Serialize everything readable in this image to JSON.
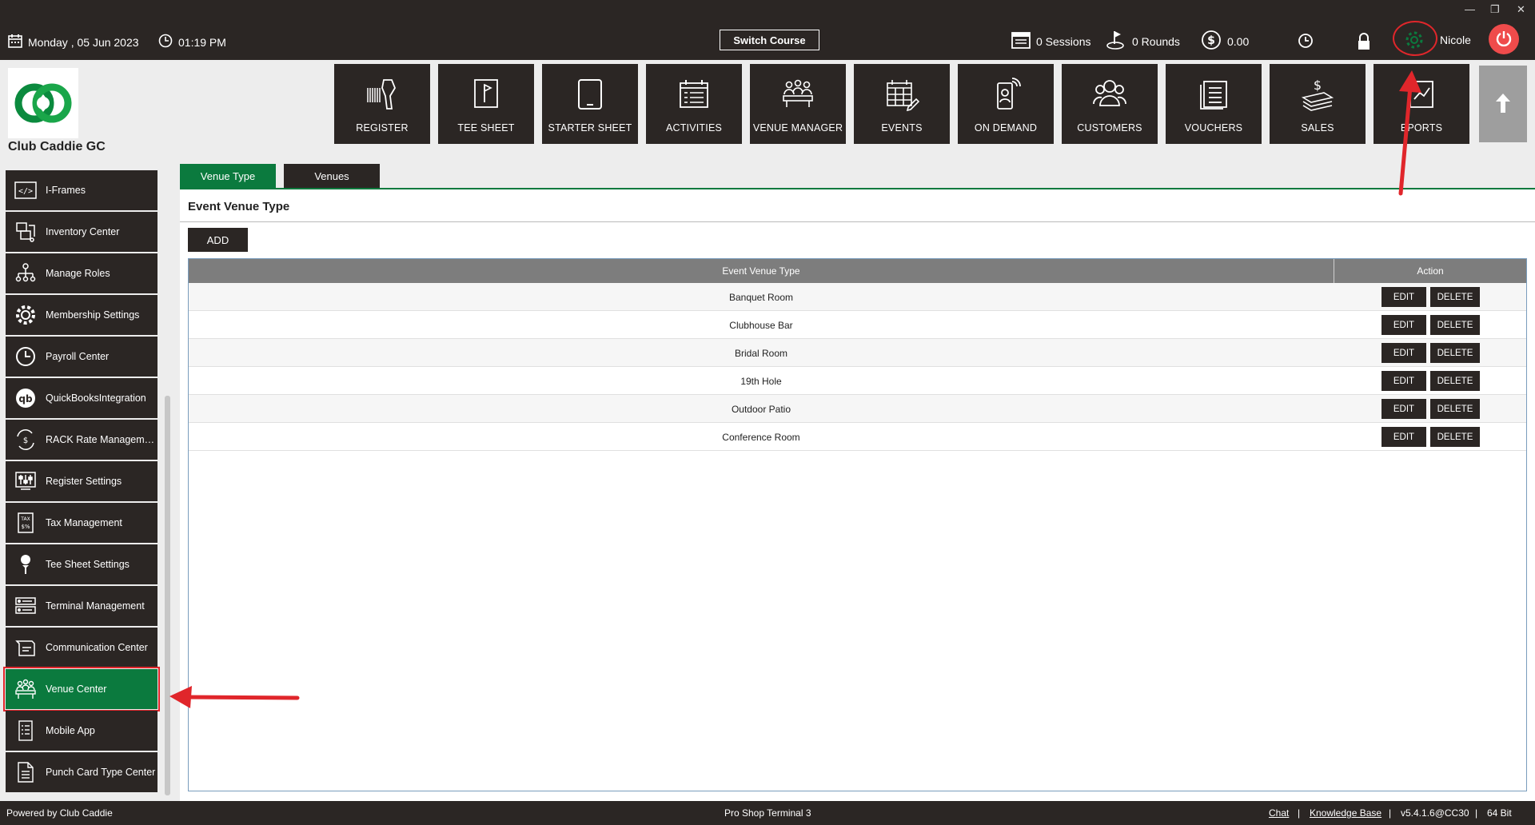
{
  "topbar": {
    "date": "Monday ,  05 Jun 2023",
    "time": "01:19 PM",
    "switch_course": "Switch Course",
    "sessions": "0 Sessions",
    "rounds": "0 Rounds",
    "balance": "0.00",
    "user": "Nicole"
  },
  "club": {
    "name": "Club Caddie GC"
  },
  "nav": [
    {
      "label": "REGISTER",
      "icon": "barcode-scanner-icon"
    },
    {
      "label": "TEE SHEET",
      "icon": "tee-sheet-icon"
    },
    {
      "label": "STARTER SHEET",
      "icon": "tablet-icon"
    },
    {
      "label": "ACTIVITIES",
      "icon": "calendar-list-icon"
    },
    {
      "label": "VENUE MANAGER",
      "icon": "venue-table-icon"
    },
    {
      "label": "EVENTS",
      "icon": "calendar-pen-icon"
    },
    {
      "label": "ON DEMAND",
      "icon": "mobile-signal-icon"
    },
    {
      "label": "CUSTOMERS",
      "icon": "people-icon"
    },
    {
      "label": "VOUCHERS",
      "icon": "voucher-icon"
    },
    {
      "label": "SALES",
      "icon": "money-icon"
    },
    {
      "label": "EPORTS",
      "icon": "report-chart-icon"
    }
  ],
  "sidebar": {
    "items": [
      {
        "label": "I-Frames",
        "icon": "code-icon"
      },
      {
        "label": "Inventory Center",
        "icon": "inventory-icon"
      },
      {
        "label": "Manage Roles",
        "icon": "org-chart-icon"
      },
      {
        "label": "Membership Settings",
        "icon": "gear-icon"
      },
      {
        "label": "Payroll Center",
        "icon": "clock-icon"
      },
      {
        "label": "QuickBooksIntegration",
        "icon": "quickbooks-icon"
      },
      {
        "label": "RACK Rate Manageme...",
        "icon": "rate-exchange-icon"
      },
      {
        "label": "Register Settings",
        "icon": "sliders-icon"
      },
      {
        "label": "Tax Management",
        "icon": "tax-icon"
      },
      {
        "label": "Tee Sheet Settings",
        "icon": "golf-tee-icon"
      },
      {
        "label": "Terminal Management",
        "icon": "terminal-icon"
      },
      {
        "label": "Communication Center",
        "icon": "communication-icon"
      },
      {
        "label": "Venue Center",
        "icon": "venue-icon"
      },
      {
        "label": "Mobile App",
        "icon": "mobile-list-icon"
      },
      {
        "label": "Punch Card Type Center",
        "icon": "document-icon"
      }
    ]
  },
  "tabs": [
    {
      "label": "Venue Type"
    },
    {
      "label": "Venues"
    }
  ],
  "main": {
    "title": "Event Venue Type",
    "add_label": "ADD",
    "columns": [
      "Event Venue Type",
      "Action"
    ],
    "rows": [
      {
        "name": "Banquet Room"
      },
      {
        "name": "Clubhouse Bar"
      },
      {
        "name": "Bridal Room"
      },
      {
        "name": "19th Hole"
      },
      {
        "name": "Outdoor Patio"
      },
      {
        "name": "Conference Room"
      }
    ],
    "edit_label": "EDIT",
    "delete_label": "DELETE"
  },
  "footer": {
    "powered": "Powered by Club Caddie",
    "terminal": "Pro Shop Terminal 3",
    "chat": "Chat",
    "sep": "|",
    "kb": "Knowledge Base",
    "version": "v5.4.1.6@CC30",
    "bits": "64 Bit"
  },
  "colors": {
    "dark": "#2b2624",
    "green": "#0b7a3e",
    "annotation_red": "#e0262b"
  }
}
